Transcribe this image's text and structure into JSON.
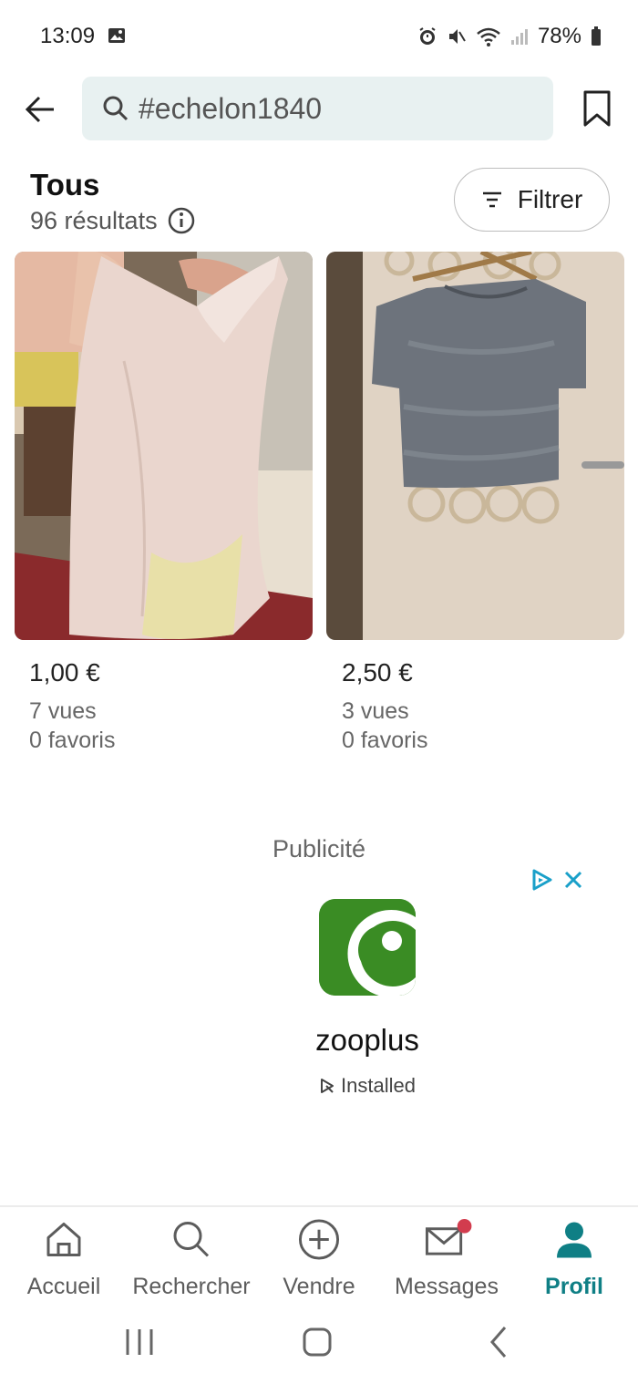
{
  "status_bar": {
    "time": "13:09",
    "battery": "78%",
    "icons": [
      "image-icon",
      "alarm-icon",
      "mute-icon",
      "wifi-icon",
      "signal-icon",
      "battery-icon"
    ]
  },
  "top_bar": {
    "search_value": "#echelon1840",
    "icons": [
      "back-arrow-icon",
      "search-icon",
      "bookmark-icon"
    ]
  },
  "results": {
    "category": "Tous",
    "count_text": "96 résultats",
    "filter_label": "Filtrer"
  },
  "products": [
    {
      "price": "1,00 €",
      "views": "7 vues",
      "favorites": "0 favoris",
      "image": "pink-sleeveless-top-photo"
    },
    {
      "price": "2,50 €",
      "views": "3 vues",
      "favorites": "0 favoris",
      "image": "gray-knit-tshirt-photo"
    }
  ],
  "ad": {
    "label": "Publicité",
    "name": "zooplus",
    "status": "Installed",
    "logo_color": "#3a8c24",
    "choices_color": "#1aa0c9"
  },
  "bottom_nav": {
    "items": [
      {
        "label": "Accueil",
        "icon": "home-icon"
      },
      {
        "label": "Rechercher",
        "icon": "search-icon"
      },
      {
        "label": "Vendre",
        "icon": "plus-circle-icon"
      },
      {
        "label": "Messages",
        "icon": "mail-icon"
      },
      {
        "label": "Profil",
        "icon": "person-icon"
      }
    ],
    "active": "Profil",
    "accent_color": "#0f7f85"
  }
}
